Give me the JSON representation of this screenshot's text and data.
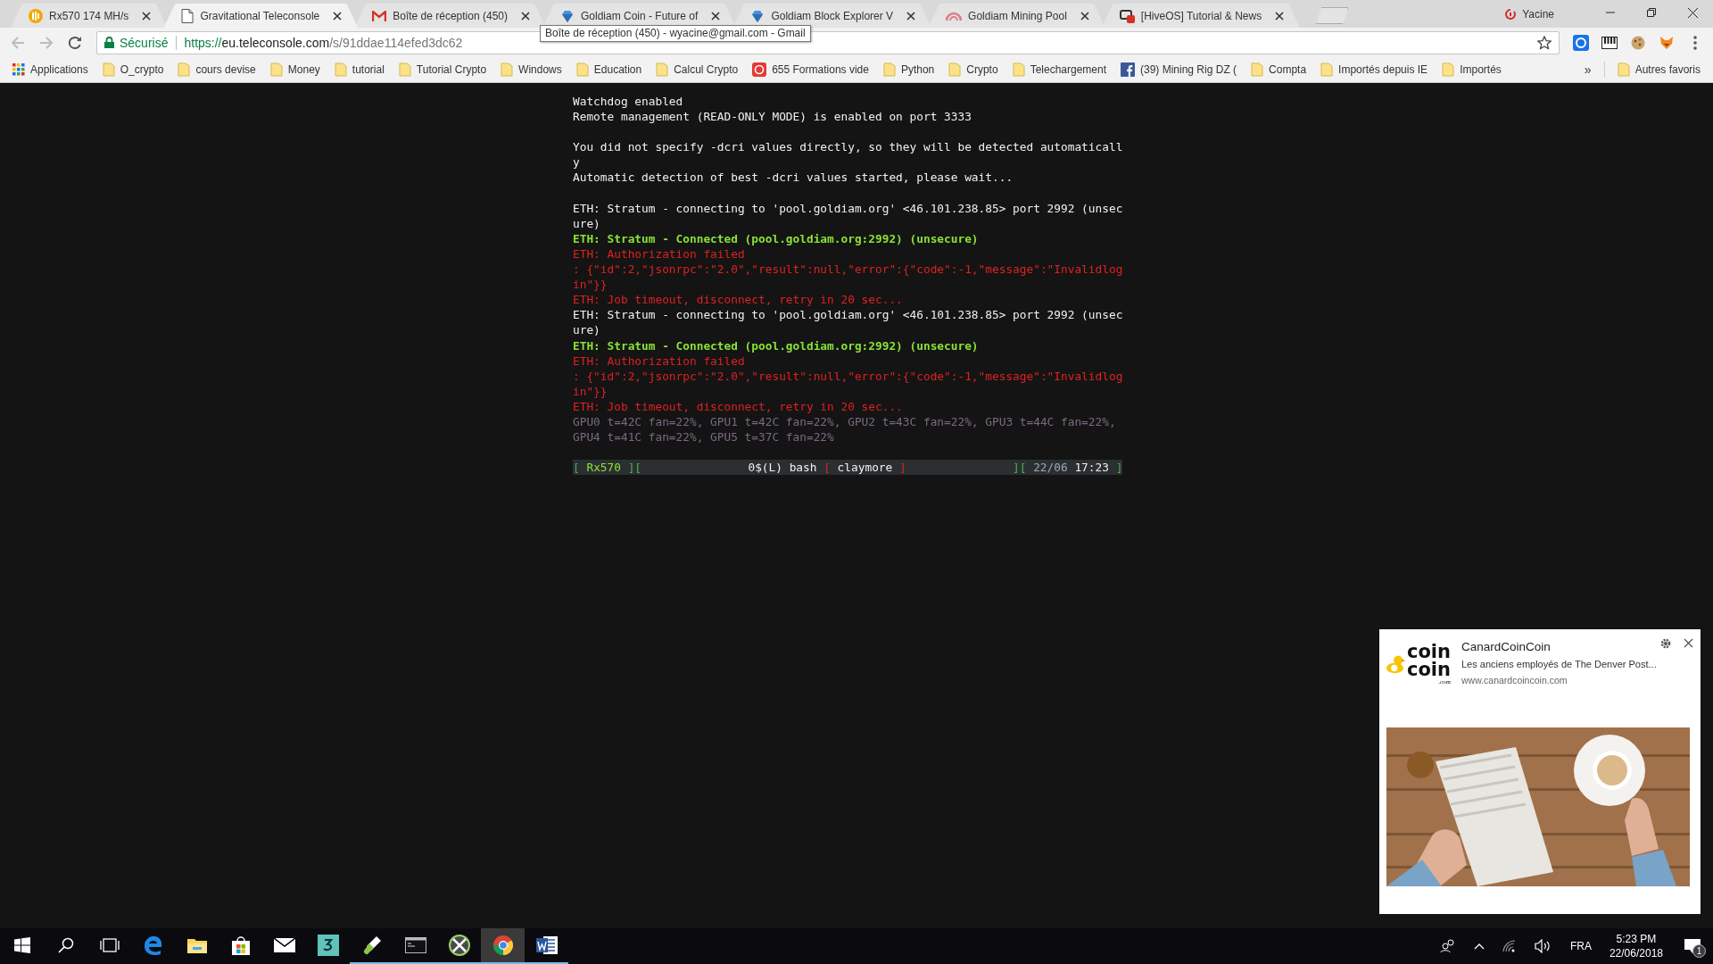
{
  "browser": {
    "tabs": [
      {
        "title": "Rx570 174 MH/s",
        "kind": "bars",
        "selected": false
      },
      {
        "title": "Gravitational Teleconsole",
        "kind": "page",
        "selected": true
      },
      {
        "title": "Boîte de réception (450)",
        "kind": "gmail",
        "selected": false
      },
      {
        "title": "Goldiam Coin - Future of",
        "kind": "gem",
        "selected": false
      },
      {
        "title": "Goldiam Block Explorer V",
        "kind": "gem",
        "selected": false
      },
      {
        "title": "Goldiam Mining Pool",
        "kind": "pool",
        "selected": false
      },
      {
        "title": "[HiveOS] Tutorial & News",
        "kind": "hive",
        "selected": false
      }
    ],
    "profile": {
      "name": "Yacine"
    },
    "tooltip": "Boîte de réception (450) - wyacine@gmail.com - Gmail",
    "address": {
      "security": "Sécurisé",
      "scheme": "https://",
      "host": "eu.teleconsole.com",
      "path": "/s/91ddae114efed3dc62"
    },
    "bookmarks": [
      {
        "kind": "apps",
        "label": "Applications"
      },
      {
        "kind": "folder",
        "label": "O_crypto"
      },
      {
        "kind": "folder",
        "label": "cours devise"
      },
      {
        "kind": "folder",
        "label": "Money"
      },
      {
        "kind": "folder",
        "label": "tutorial"
      },
      {
        "kind": "folder",
        "label": "Tutorial Crypto"
      },
      {
        "kind": "folder",
        "label": "Windows"
      },
      {
        "kind": "folder",
        "label": "Education"
      },
      {
        "kind": "folder",
        "label": "Calcul Crypto"
      },
      {
        "kind": "video",
        "label": "655 Formations vide"
      },
      {
        "kind": "folder",
        "label": "Python"
      },
      {
        "kind": "folder",
        "label": "Crypto"
      },
      {
        "kind": "folder",
        "label": "Telechargement"
      },
      {
        "kind": "facebook",
        "label": "(39) Mining Rig DZ ("
      },
      {
        "kind": "folder",
        "label": "Compta"
      },
      {
        "kind": "folder",
        "label": "Importés depuis IE"
      },
      {
        "kind": "folder",
        "label": "Importés"
      }
    ],
    "bookmarks_more": "»",
    "other_bookmarks": "Autres favoris"
  },
  "terminal": {
    "lines": [
      {
        "kind": "normal",
        "text": "Watchdog enabled"
      },
      {
        "kind": "normal",
        "text": "Remote management (READ-ONLY MODE) is enabled on port 3333"
      },
      {
        "kind": "blank"
      },
      {
        "kind": "normal",
        "text": "You did not specify -dcri values directly, so they will be detected automatically"
      },
      {
        "kind": "normal",
        "text": "Automatic detection of best -dcri values started, please wait..."
      },
      {
        "kind": "blank"
      },
      {
        "kind": "normal",
        "text": "ETH: Stratum - connecting to 'pool.goldiam.org' <46.101.238.85> port 2992 (unsecure)"
      },
      {
        "kind": "success",
        "text": "ETH: Stratum - Connected (pool.goldiam.org:2992) (unsecure)"
      },
      {
        "kind": "error",
        "text": "ETH: Authorization failed"
      },
      {
        "kind": "error",
        "text": ": {\"id\":2,\"jsonrpc\":\"2.0\",\"result\":null,\"error\":{\"code\":-1,\"message\":\"Invalidlogin\"}}"
      },
      {
        "kind": "error",
        "text": "ETH: Job timeout, disconnect, retry in 20 sec..."
      },
      {
        "kind": "normal",
        "text": "ETH: Stratum - connecting to 'pool.goldiam.org' <46.101.238.85> port 2992 (unsecure)"
      },
      {
        "kind": "success",
        "text": "ETH: Stratum - Connected (pool.goldiam.org:2992) (unsecure)"
      },
      {
        "kind": "error",
        "text": "ETH: Authorization failed"
      },
      {
        "kind": "error",
        "text": ": {\"id\":2,\"jsonrpc\":\"2.0\",\"result\":null,\"error\":{\"code\":-1,\"message\":\"Invalidlogin\"}}"
      },
      {
        "kind": "error",
        "text": "ETH: Job timeout, disconnect, retry in 20 sec..."
      },
      {
        "kind": "stats",
        "text": "GPU0 t=42C fan=22%, GPU1 t=42C fan=22%, GPU2 t=43C fan=22%, GPU3 t=44C fan=22%, GPU4 t=41C fan=22%, GPU5 t=37C fan=22%"
      }
    ],
    "status_bar": {
      "left": [
        {
          "kind": "frame",
          "text": "["
        },
        {
          "kind": "session",
          "text": "Rx570"
        },
        {
          "kind": "frame",
          "text": "]["
        }
      ],
      "center": [
        {
          "kind": "window",
          "text": "0$(L) bash"
        },
        {
          "kind": "mark",
          "text": "["
        },
        {
          "kind": "window",
          "text": "claymore"
        },
        {
          "kind": "mark",
          "text": "]"
        }
      ],
      "right": [
        {
          "kind": "frame",
          "text": "]["
        },
        {
          "kind": "date",
          "text": "22/06"
        },
        {
          "kind": "window",
          "text": "17:23"
        },
        {
          "kind": "frame",
          "text": "]"
        }
      ]
    }
  },
  "notification": {
    "title": "CanardCoinCoin",
    "body": "Les anciens employés de The Denver Post...",
    "site": "www.canardcoincoin.com",
    "logo": {
      "lines": [
        "coin",
        "coin"
      ],
      "suffix": ".com"
    }
  },
  "taskbar": {
    "items": [
      {
        "kind": "start",
        "running": false,
        "selected": false
      },
      {
        "kind": "search",
        "running": false,
        "selected": false
      },
      {
        "kind": "taskview",
        "running": false,
        "selected": false
      },
      {
        "kind": "edge",
        "running": false,
        "selected": false
      },
      {
        "kind": "explorer",
        "running": false,
        "selected": false
      },
      {
        "kind": "store",
        "running": false,
        "selected": false
      },
      {
        "kind": "mail",
        "running": false,
        "selected": false
      },
      {
        "kind": "max",
        "running": false,
        "selected": false
      },
      {
        "kind": "pen",
        "running": true,
        "selected": false
      },
      {
        "kind": "console",
        "running": true,
        "selected": false
      },
      {
        "kind": "xbox",
        "running": true,
        "selected": false
      },
      {
        "kind": "chrome",
        "running": true,
        "selected": true
      },
      {
        "kind": "word",
        "running": true,
        "selected": false
      }
    ],
    "tray": {
      "language": "FRA",
      "time": "5:23 PM",
      "date": "22/06/2018",
      "notifications": "1"
    }
  }
}
